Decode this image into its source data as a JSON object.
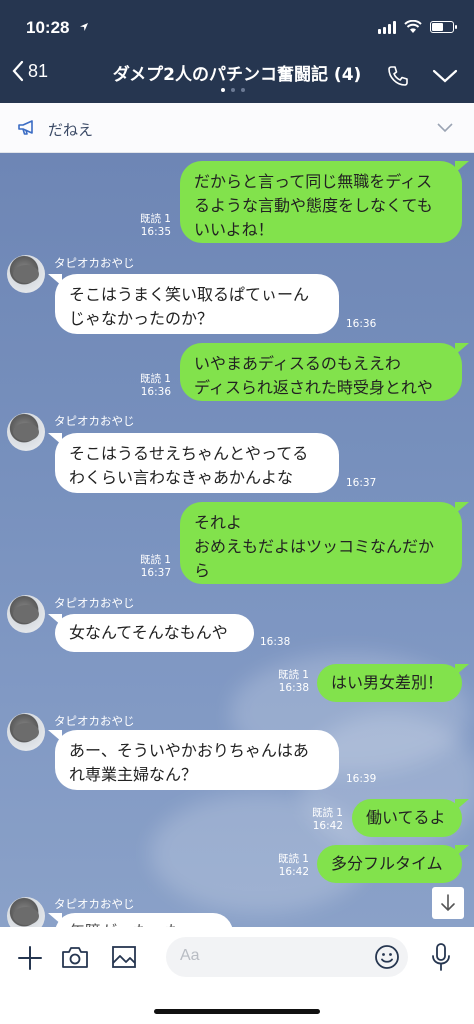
{
  "status": {
    "time": "10:28"
  },
  "header": {
    "back_count": "81",
    "title": "ダメプ2人のパチンコ奮闘記 (4)"
  },
  "announcement": {
    "text": "だねえ"
  },
  "messages": [
    {
      "side": "out",
      "text": "だからと言って同じ無職をディス\nるような言動や態度をしなくても\nいいよね！",
      "read": "既読 1",
      "time": "16:35"
    },
    {
      "side": "in",
      "sender": "タピオカおやじ",
      "text": "そこはうまく笑い取るぱてぃーん\nじゃなかったのか？",
      "time": "16:36"
    },
    {
      "side": "out",
      "text": "いやまあディスるのもええわ\nディスられ返された時受身とれや",
      "read": "既読 1",
      "time": "16:36"
    },
    {
      "side": "in",
      "sender": "タピオカおやじ",
      "text": "そこはうるせえちゃんとやってる\nわくらい言わなきゃあかんよな",
      "time": "16:37"
    },
    {
      "side": "out",
      "text": "それよ\nおめえもだよはツッコミなんだか\nら",
      "read": "既読 1",
      "time": "16:37"
    },
    {
      "side": "in",
      "sender": "タピオカおやじ",
      "text": "女なんてそんなもんや",
      "time": "16:38"
    },
    {
      "side": "out",
      "text": "はい男女差別！",
      "read": "既読 1",
      "time": "16:38"
    },
    {
      "side": "in",
      "sender": "タピオカおやじ",
      "text": "あー、そういやかおりちゃんはあ\nれ専業主婦なん？",
      "time": "16:39"
    },
    {
      "side": "out",
      "text": "働いてるよ",
      "read": "既読 1",
      "time": "16:42"
    },
    {
      "side": "out",
      "text": "多分フルタイム",
      "read": "既読 1",
      "time": "16:42"
    },
    {
      "side": "in",
      "sender": "タピオカおやじ",
      "text": "年障がーたーたー"
    }
  ],
  "input": {
    "placeholder": "Aa"
  },
  "icons": {
    "back": "chevron-left-icon",
    "call": "phone-icon",
    "menu": "chevron-down-icon",
    "announce": "megaphone-icon",
    "plus": "plus-icon",
    "camera": "camera-icon",
    "image": "image-icon",
    "emoji": "smiley-icon",
    "mic": "microphone-icon",
    "scroll": "arrow-down-icon"
  },
  "colors": {
    "header": "#263650",
    "outgoing": "#82e24c",
    "incoming": "#ffffff",
    "chat_bg": "#7790bd"
  }
}
